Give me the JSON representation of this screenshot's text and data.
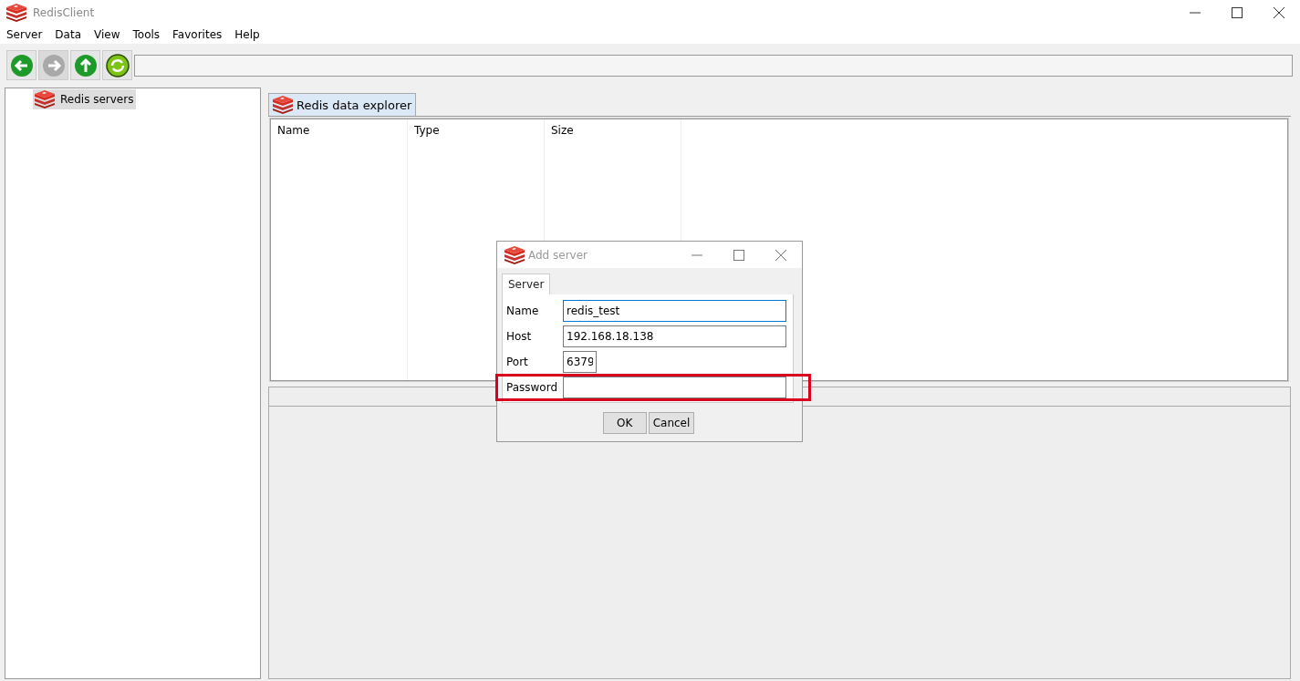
{
  "window": {
    "title": "RedisClient"
  },
  "menu": [
    "Server",
    "Data",
    "View",
    "Tools",
    "Favorites",
    "Help"
  ],
  "toolbar": [
    {
      "kind": "back",
      "disabled": false
    },
    {
      "kind": "forward",
      "disabled": true
    },
    {
      "kind": "up",
      "disabled": false
    },
    {
      "kind": "refresh",
      "disabled": false
    }
  ],
  "tree": [
    {
      "label": "Redis servers",
      "selected": true
    }
  ],
  "tabs": [
    {
      "label": "Redis data explorer",
      "selected": true
    }
  ],
  "table": {
    "columns": [
      "Name",
      "Type",
      "Size"
    ]
  },
  "dialog": {
    "title": "Add server",
    "tabs": [
      {
        "label": "Server",
        "selected": true
      }
    ],
    "fields": [
      {
        "kind": "text",
        "label": "Name",
        "value": "redis_test",
        "focused": true,
        "highlighted": false
      },
      {
        "kind": "text",
        "label": "Host",
        "value": "192.168.18.138",
        "focused": false,
        "highlighted": false
      },
      {
        "kind": "port",
        "label": "Port",
        "value": "6379",
        "focused": false,
        "highlighted": false
      },
      {
        "kind": "text",
        "label": "Password",
        "focused": false,
        "highlighted": true
      }
    ],
    "buttons": [
      "OK",
      "Cancel"
    ]
  }
}
